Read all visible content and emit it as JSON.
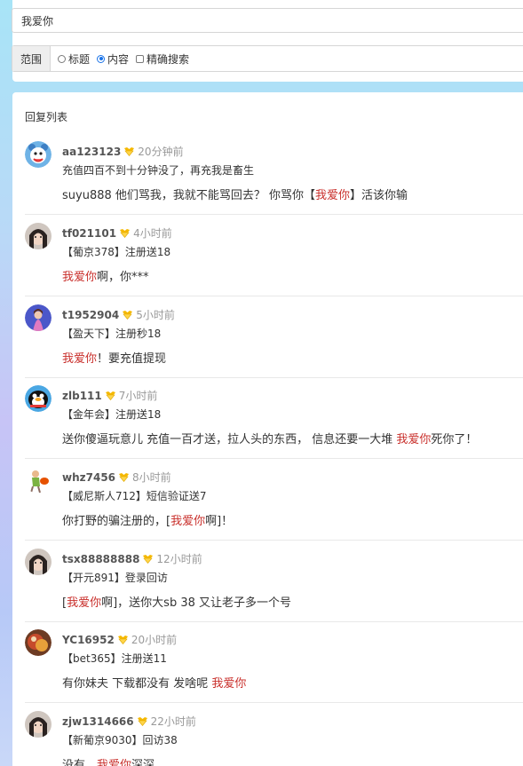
{
  "search": {
    "query": "我爱你"
  },
  "range": {
    "label": "范围",
    "options": [
      {
        "label": "标题",
        "type": "radio",
        "checked": false
      },
      {
        "label": "内容",
        "type": "radio",
        "checked": true
      },
      {
        "label": "精确搜索",
        "type": "checkbox",
        "checked": false
      }
    ]
  },
  "list": {
    "title": "回复列表",
    "replies": [
      {
        "user": "aa123123",
        "time": "20分钟前",
        "source": "充值四百不到十分钟没了，再充我是畜生",
        "content_pre": "suyu888 他们骂我，我就不能骂回去？ 你骂你【",
        "content_hl": "我爱你",
        "content_post": "】活该你输"
      },
      {
        "user": "tf021101",
        "time": "4小时前",
        "source": "【葡京378】注册送18",
        "content_pre": "",
        "content_hl": "我爱你",
        "content_post": "啊，你***"
      },
      {
        "user": "t1952904",
        "time": "5小时前",
        "source": "【盈天下】注册秒18",
        "content_pre": "",
        "content_hl": "我爱你",
        "content_post": "！要充值提现"
      },
      {
        "user": "zlb111",
        "time": "7小时前",
        "source": "【金年会】注册送18",
        "content_pre": "送你傻逼玩意儿 充值一百才送，拉人头的东西，  信息还要一大堆 ",
        "content_hl": "我爱你",
        "content_post": "死你了！"
      },
      {
        "user": "whz7456",
        "time": "8小时前",
        "source": "【威尼斯人712】短信验证送7",
        "content_pre": "你打野的骗注册的，[",
        "content_hl": "我爱你",
        "content_post": "啊]！"
      },
      {
        "user": "tsx88888888",
        "time": "12小时前",
        "source": "【开元891】登录回访",
        "content_pre": "[",
        "content_hl": "我爱你",
        "content_post": "啊]，送你大sb 38 又让老子多一个号"
      },
      {
        "user": "YC16952",
        "time": "20小时前",
        "source": "【bet365】注册送11",
        "content_pre": "有你妹夫 下载都没有 发啥呢 ",
        "content_hl": "我爱你",
        "content_post": ""
      },
      {
        "user": "zjw1314666",
        "time": "22小时前",
        "source": "【新葡京9030】回访38",
        "content_pre": "没有，",
        "content_hl": "我爱你",
        "content_post": "深深"
      }
    ]
  },
  "colors": {
    "highlight": "#c9302c",
    "accent": "#1a73e8",
    "vip_badge": "#f5b800"
  }
}
